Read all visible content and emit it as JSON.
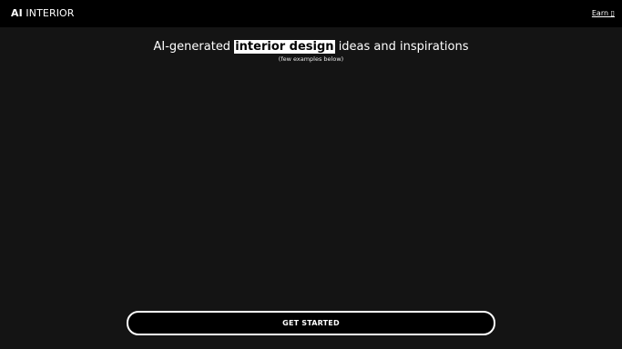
{
  "header": {
    "brand_bold": "AI",
    "brand_rest": "INTERIOR",
    "earn_link": "Earn ▯"
  },
  "hero": {
    "headline_before": "AI-generated ",
    "headline_highlight": "interior design",
    "headline_after": " ideas and inspirations",
    "subnote": "(few examples below)"
  },
  "cta": {
    "label": "GET STARTED"
  },
  "colors": {
    "topbar_bg": "#000000",
    "page_bg": "#141414",
    "highlight_bg": "#ffffff",
    "text": "#ffffff"
  }
}
